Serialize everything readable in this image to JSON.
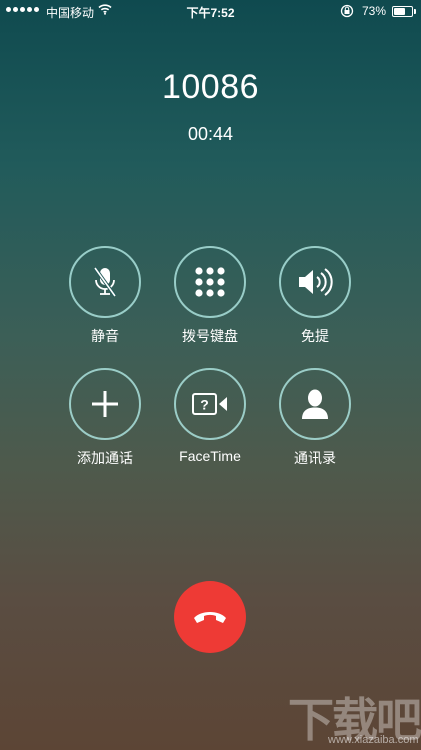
{
  "status_bar": {
    "carrier": "中国移动",
    "time": "下午7:52",
    "battery": "73%",
    "battery_fraction": 0.73
  },
  "call": {
    "number": "10086",
    "duration": "00:44"
  },
  "controls": {
    "mute": "静音",
    "keypad": "拨号键盘",
    "speaker": "免提",
    "add_call": "添加通话",
    "facetime": "FaceTime",
    "contacts": "通讯录"
  },
  "accent_colors": {
    "button_ring": "#aae1dc",
    "end_call": "#ee3a35"
  },
  "watermark": {
    "logo": "下载吧",
    "url": "www.xiazaiba.com"
  }
}
